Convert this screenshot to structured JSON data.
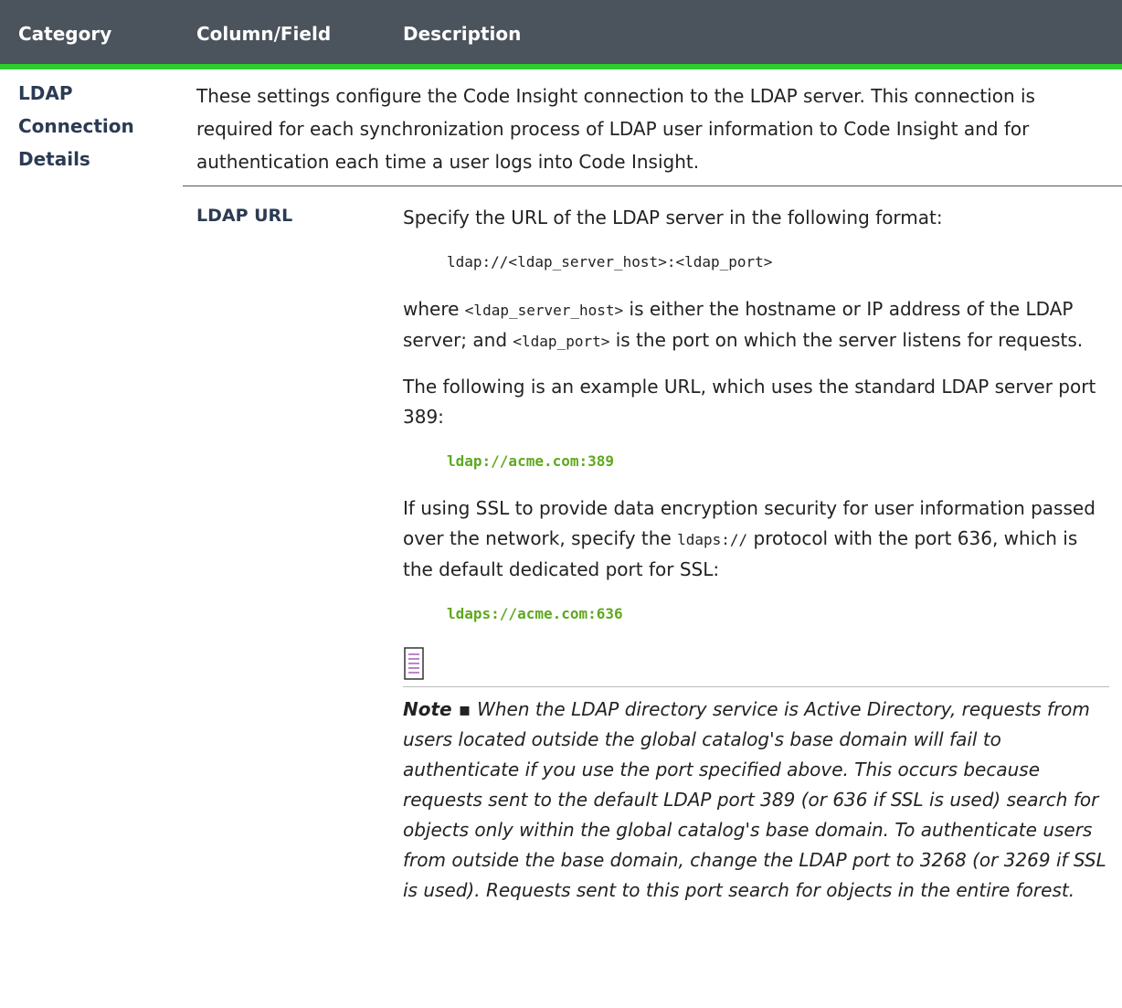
{
  "header": {
    "category": "Category",
    "column_field": "Column/Field",
    "description": "Description"
  },
  "category": "LDAP Connection Details",
  "intro": "These settings configure the Code Insight connection to the LDAP server. This connection is required for each synchronization process of LDAP user information to Code Insight and for authentication each time a user logs into Code Insight.",
  "field": "LDAP URL",
  "desc": {
    "p1": "Specify the URL of the LDAP server in the following format:",
    "format_code": "ldap://<ldap_server_host>:<ldap_port>",
    "p2_a": "where ",
    "p2_host": "<ldap_server_host>",
    "p2_b": " is either the hostname or IP address of the LDAP server; and ",
    "p2_port": "<ldap_port>",
    "p2_c": " is the port on which the server listens for requests.",
    "p3": "The following is an example URL, which uses the standard LDAP server port 389:",
    "example1": "ldap://acme.com:389",
    "p4_a": "If using SSL to provide data encryption security for user information passed over the network, specify the ",
    "p4_proto": "ldaps://",
    "p4_b": " protocol with the port 636, which is the default dedicated port for SSL:",
    "example2": "ldaps://acme.com:636"
  },
  "note": {
    "icon": "note-icon",
    "lead": "Note ▪ ",
    "text": "When the LDAP directory service is Active Directory, requests from users located outside the global catalog's base domain will fail to authenticate if you use the port specified above. This occurs because requests sent to the default LDAP port 389 (or 636 if SSL is used) search for objects only within the global catalog's base domain. To authenticate users from outside the base domain, change the LDAP port to 3268 (or 3269 if SSL is used). Requests sent to this port search for objects in the entire forest."
  },
  "colors": {
    "header_bg": "#4b535c",
    "header_accent": "#2dcc2d",
    "code_green": "#5fa81f",
    "label_color": "#2b3b52",
    "note_icon": "#a04fb0"
  }
}
